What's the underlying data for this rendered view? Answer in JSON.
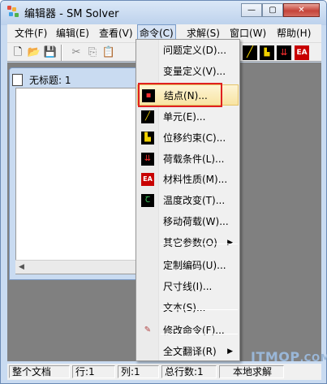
{
  "window": {
    "title": "编辑器 - SM Solver"
  },
  "menubar": [
    {
      "label": "文件(F)"
    },
    {
      "label": "编辑(E)"
    },
    {
      "label": "查看(V)"
    },
    {
      "label": "命令(C)"
    },
    {
      "label": "求解(S)"
    },
    {
      "label": "窗口(W)"
    },
    {
      "label": "帮助(H)"
    }
  ],
  "child_window": {
    "title": "无标题: 1"
  },
  "dropdown": {
    "items": [
      {
        "label": "问题定义(D)...",
        "icon": ""
      },
      {
        "label": "变量定义(V)...",
        "icon": ""
      },
      {
        "label": "结点(N)...",
        "icon": "node-icon"
      },
      {
        "label": "单元(E)...",
        "icon": "element-icon"
      },
      {
        "label": "位移约束(C)...",
        "icon": "constraint-icon"
      },
      {
        "label": "荷载条件(L)...",
        "icon": "load-icon"
      },
      {
        "label": "材料性质(M)...",
        "icon": "material-icon"
      },
      {
        "label": "温度改变(T)...",
        "icon": "temperature-icon"
      },
      {
        "label": "移动荷载(W)...",
        "icon": ""
      },
      {
        "label": "其它参数(O)",
        "icon": "",
        "submenu": true
      },
      {
        "label": "定制编码(U)...",
        "icon": ""
      },
      {
        "label": "尺寸线(I)...",
        "icon": ""
      },
      {
        "label": "文本(S)...",
        "icon": ""
      },
      {
        "label": "修改命令(F)...",
        "icon": "edit-command-icon"
      },
      {
        "label": "全文翻译(R)",
        "icon": "",
        "submenu": true
      }
    ]
  },
  "statusbar": [
    {
      "label": "整个文档"
    },
    {
      "label": "行:1"
    },
    {
      "label": "列:1"
    },
    {
      "label": "总行数:1"
    },
    {
      "label": "本地求解"
    }
  ],
  "watermark": {
    "main": "ITMOP",
    "suffix": ".COM"
  },
  "colors": {
    "highlight": "#f8e4a3",
    "redbox": "#e02020",
    "mdi": "#808080"
  }
}
